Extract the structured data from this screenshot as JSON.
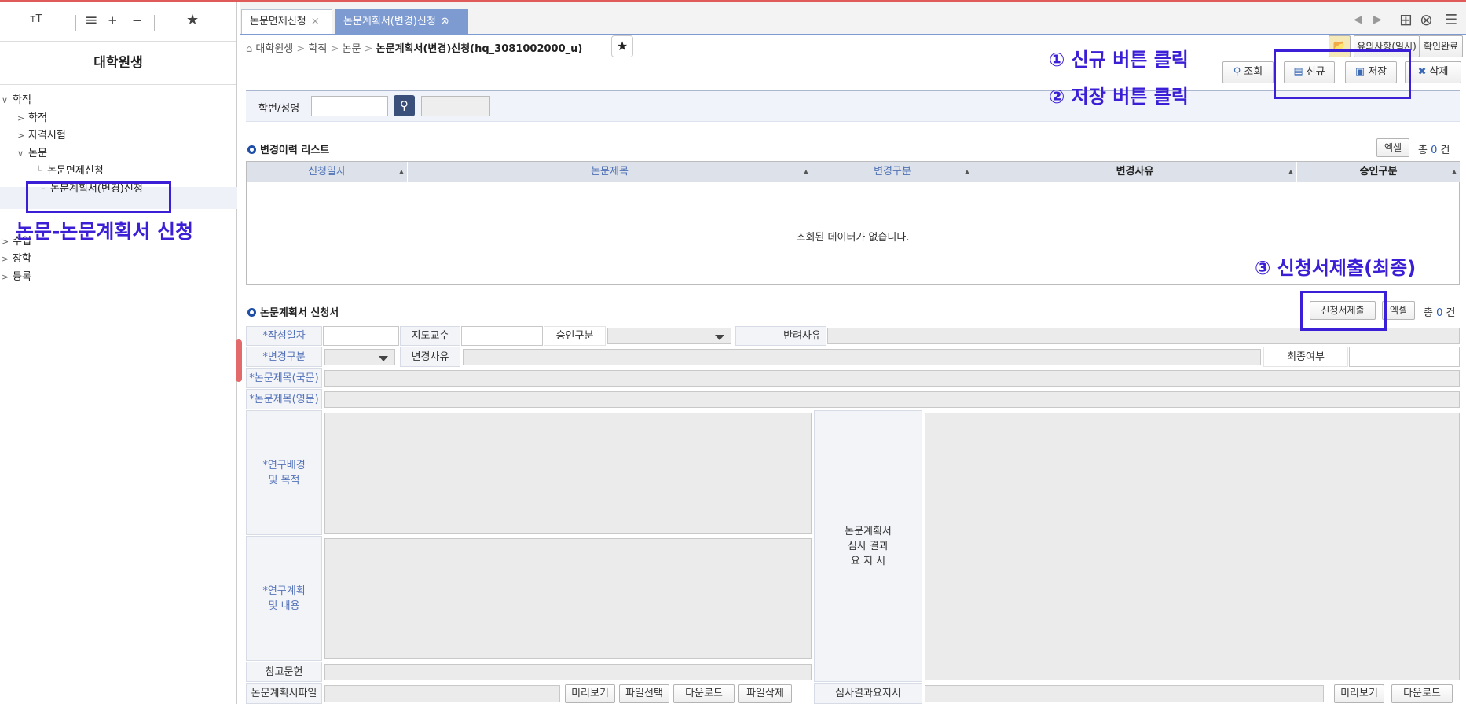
{
  "left_panel": {
    "toolbar": {
      "font_size": "ᴛT",
      "menu": "≡",
      "plus": "+",
      "minus": "−",
      "star": "★"
    },
    "title": "대학원생",
    "tree": [
      {
        "label": "학적",
        "level": 0,
        "chevron": "∨"
      },
      {
        "label": "학적",
        "level": 1,
        "chevron": ">"
      },
      {
        "label": "자격시험",
        "level": 1,
        "chevron": ">"
      },
      {
        "label": "논문",
        "level": 1,
        "chevron": "∨"
      },
      {
        "label": "논문면제신청",
        "level": 2,
        "chevron": "└"
      },
      {
        "label": "논문계획서(변경)신청",
        "level": 2,
        "chevron": "└"
      },
      {
        "label": "수업",
        "level": 0,
        "chevron": ">"
      },
      {
        "label": "장학",
        "level": 0,
        "chevron": ">"
      },
      {
        "label": "등록",
        "level": 0,
        "chevron": ">"
      }
    ],
    "annotation": "논문-논문계획서 신청"
  },
  "tabs": [
    {
      "label": "논문면제신청",
      "close": "×"
    },
    {
      "label": "논문계획서(변경)신청",
      "close": "⊗"
    }
  ],
  "tab_controls": {
    "prev": "◀",
    "next": "▶",
    "add": "⊞",
    "close_all": "⊗",
    "menu": "☰"
  },
  "breadcrumb": {
    "home": "⌂",
    "items": [
      "대학원생",
      "학적",
      "논문",
      "논문계획서(변경)신청(hq_3081002000_u)"
    ],
    "sep": ">",
    "star": "★"
  },
  "top_buttons": {
    "notice": "유의사항(일시)",
    "confirm": "확인완료"
  },
  "action_buttons": {
    "search": "조회",
    "new": "신규",
    "save": "저장",
    "delete": "삭제"
  },
  "annotations": {
    "step1": "① 신규 버튼 클릭",
    "step2": "② 저장 버튼 클릭",
    "step3": "③ 신청서제출(최종)"
  },
  "search": {
    "label": "학번/성명",
    "value": ""
  },
  "history": {
    "title": "변경이력 리스트",
    "excel": "엑셀",
    "count_prefix": "총",
    "count": "0",
    "count_suffix": "건",
    "columns": [
      "신청일자",
      "논문제목",
      "변경구분",
      "변경사유",
      "승인구분"
    ],
    "empty_message": "조회된 데이터가 없습니다."
  },
  "application": {
    "title": "논문계획서 신청서",
    "submit": "신청서제출",
    "excel": "엑셀",
    "count_prefix": "총",
    "count": "0",
    "count_suffix": "건",
    "labels": {
      "write_date": "*작성일자",
      "advisor": "지도교수",
      "approval": "승인구분",
      "reject_reason": "반려사유",
      "change_type": "*변경구분",
      "change_reason": "변경사유",
      "final": "최종여부",
      "title_ko": "*논문제목(국문)",
      "title_en": "*논문제목(영문)",
      "background_1": "*연구배경",
      "background_2": "및 목적",
      "plan_1": "*연구계획",
      "plan_2": "및 내용",
      "review_1": "논문계획서",
      "review_2": "심사 결과",
      "review_3": "요 지 서",
      "references": "참고문헌",
      "plan_file": "논문계획서파일",
      "review_file": "심사결과요지서"
    },
    "file_buttons": {
      "preview": "미리보기",
      "select": "파일선택",
      "download": "다운로드",
      "delete": "파일삭제"
    }
  }
}
